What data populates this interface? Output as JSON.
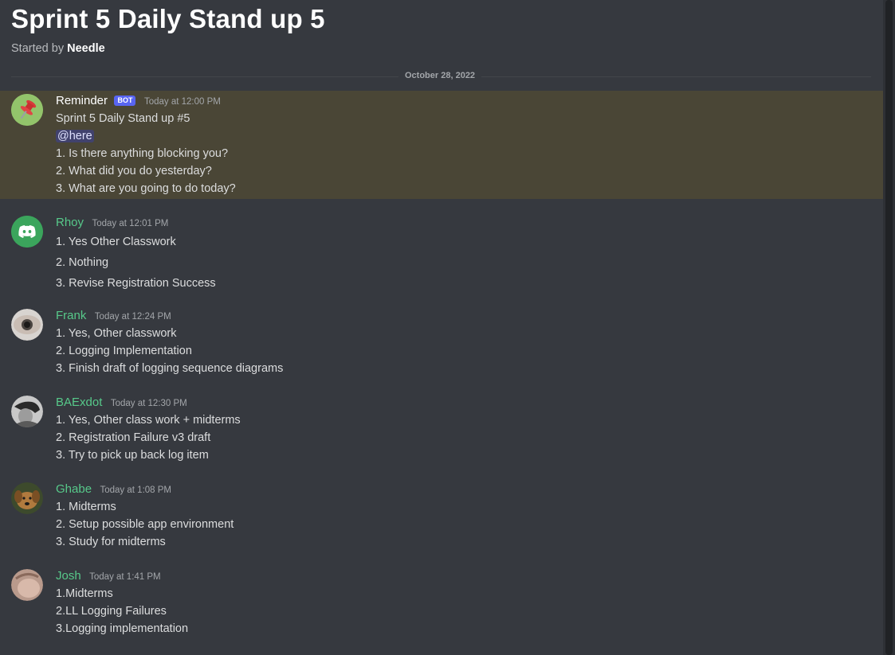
{
  "thread": {
    "title": "Sprint 5 Daily Stand up 5",
    "started_prefix": "Started by",
    "started_by": "Needle"
  },
  "date_divider": "October 28, 2022",
  "colors": {
    "background": "#36393f",
    "highlight": "#4a4636",
    "name_green": "#57c98a",
    "bot_tag": "#5865f2"
  },
  "messages": [
    {
      "author": "Reminder",
      "badge": "BOT",
      "timestamp": "Today at 12:00 PM",
      "avatar_icon": "pushpin-icon",
      "lines": [
        "Sprint 5 Daily Stand up #5",
        "@here",
        "1. Is there anything blocking you?",
        "2. What did you do yesterday?",
        "3. What are you going to do today?"
      ]
    },
    {
      "author": "Rhoy",
      "timestamp": "Today at 12:01 PM",
      "avatar_icon": "discord-logo-icon",
      "lines": [
        "1. Yes Other Classwork",
        "2. Nothing",
        "3. Revise Registration Success"
      ]
    },
    {
      "author": "Frank",
      "timestamp": "Today at 12:24 PM",
      "avatar_icon": "eye-avatar",
      "lines": [
        "1. Yes, Other classwork",
        "2. Logging Implementation",
        "3. Finish draft of logging sequence diagrams"
      ]
    },
    {
      "author": "BAExdot",
      "timestamp": "Today at 12:30 PM",
      "avatar_icon": "person-avatar",
      "lines": [
        "1. Yes, Other class work + midterms",
        "2. Registration Failure v3 draft",
        "3. Try to pick up back log item"
      ]
    },
    {
      "author": "Ghabe",
      "timestamp": "Today at 1:08 PM",
      "avatar_icon": "dog-avatar",
      "lines": [
        "1. Midterms",
        "2. Setup possible app environment",
        "3. Study for midterms"
      ]
    },
    {
      "author": "Josh",
      "timestamp": "Today at 1:41 PM",
      "avatar_icon": "photo-avatar",
      "lines": [
        "1.Midterms",
        "2.LL Logging Failures",
        "3.Logging implementation"
      ]
    }
  ]
}
